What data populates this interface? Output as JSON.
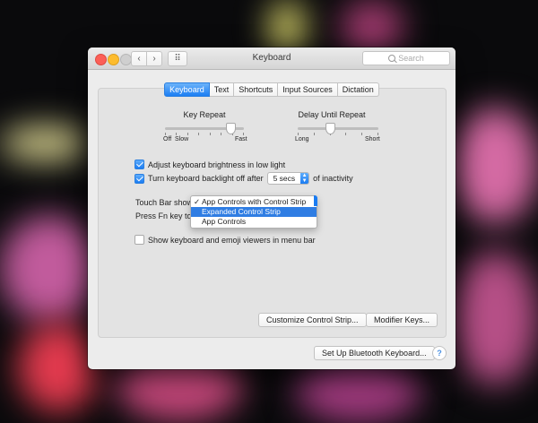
{
  "window": {
    "title": "Keyboard"
  },
  "toolbar": {
    "back_glyph": "‹",
    "forward_glyph": "›",
    "grid_glyph": "⠿"
  },
  "search": {
    "placeholder": "Search"
  },
  "tabs": [
    {
      "label": "Keyboard",
      "active": true
    },
    {
      "label": "Text",
      "active": false
    },
    {
      "label": "Shortcuts",
      "active": false
    },
    {
      "label": "Input Sources",
      "active": false
    },
    {
      "label": "Dictation",
      "active": false
    }
  ],
  "key_repeat": {
    "label": "Key Repeat",
    "left_label_1": "Off",
    "left_label_2": "Slow",
    "right_label": "Fast",
    "value_fraction": 0.83,
    "ticks": 8
  },
  "delay_until_repeat": {
    "label": "Delay Until Repeat",
    "left_label": "Long",
    "right_label": "Short",
    "value_fraction": 0.4,
    "ticks": 6
  },
  "settings": {
    "adjust_brightness": {
      "label": "Adjust keyboard brightness in low light",
      "checked": true
    },
    "backlight_off": {
      "label_prefix": "Turn keyboard backlight off after",
      "value": "5 secs",
      "label_suffix": "of inactivity",
      "checked": true
    },
    "touch_bar_label": "Touch Bar shows",
    "press_fn_label": "Press Fn key to",
    "emoji_viewers": {
      "label": "Show keyboard and emoji viewers in menu bar",
      "checked": false
    }
  },
  "touch_bar_menu": {
    "check_glyph": "✓",
    "items": [
      {
        "label": "App Controls with Control Strip",
        "checked": true,
        "selected": false
      },
      {
        "label": "Expanded Control Strip",
        "checked": false,
        "selected": true
      },
      {
        "label": "App Controls",
        "checked": false,
        "selected": false
      }
    ]
  },
  "buttons": {
    "customize": "Customize Control Strip...",
    "modifier_keys": "Modifier Keys...",
    "bluetooth": "Set Up Bluetooth Keyboard...",
    "help": "?"
  },
  "colors": {
    "accent": "#1c7ef3",
    "menu_highlight": "#2f7de3",
    "close": "#fc5f57",
    "minimize": "#fdbc2e"
  }
}
